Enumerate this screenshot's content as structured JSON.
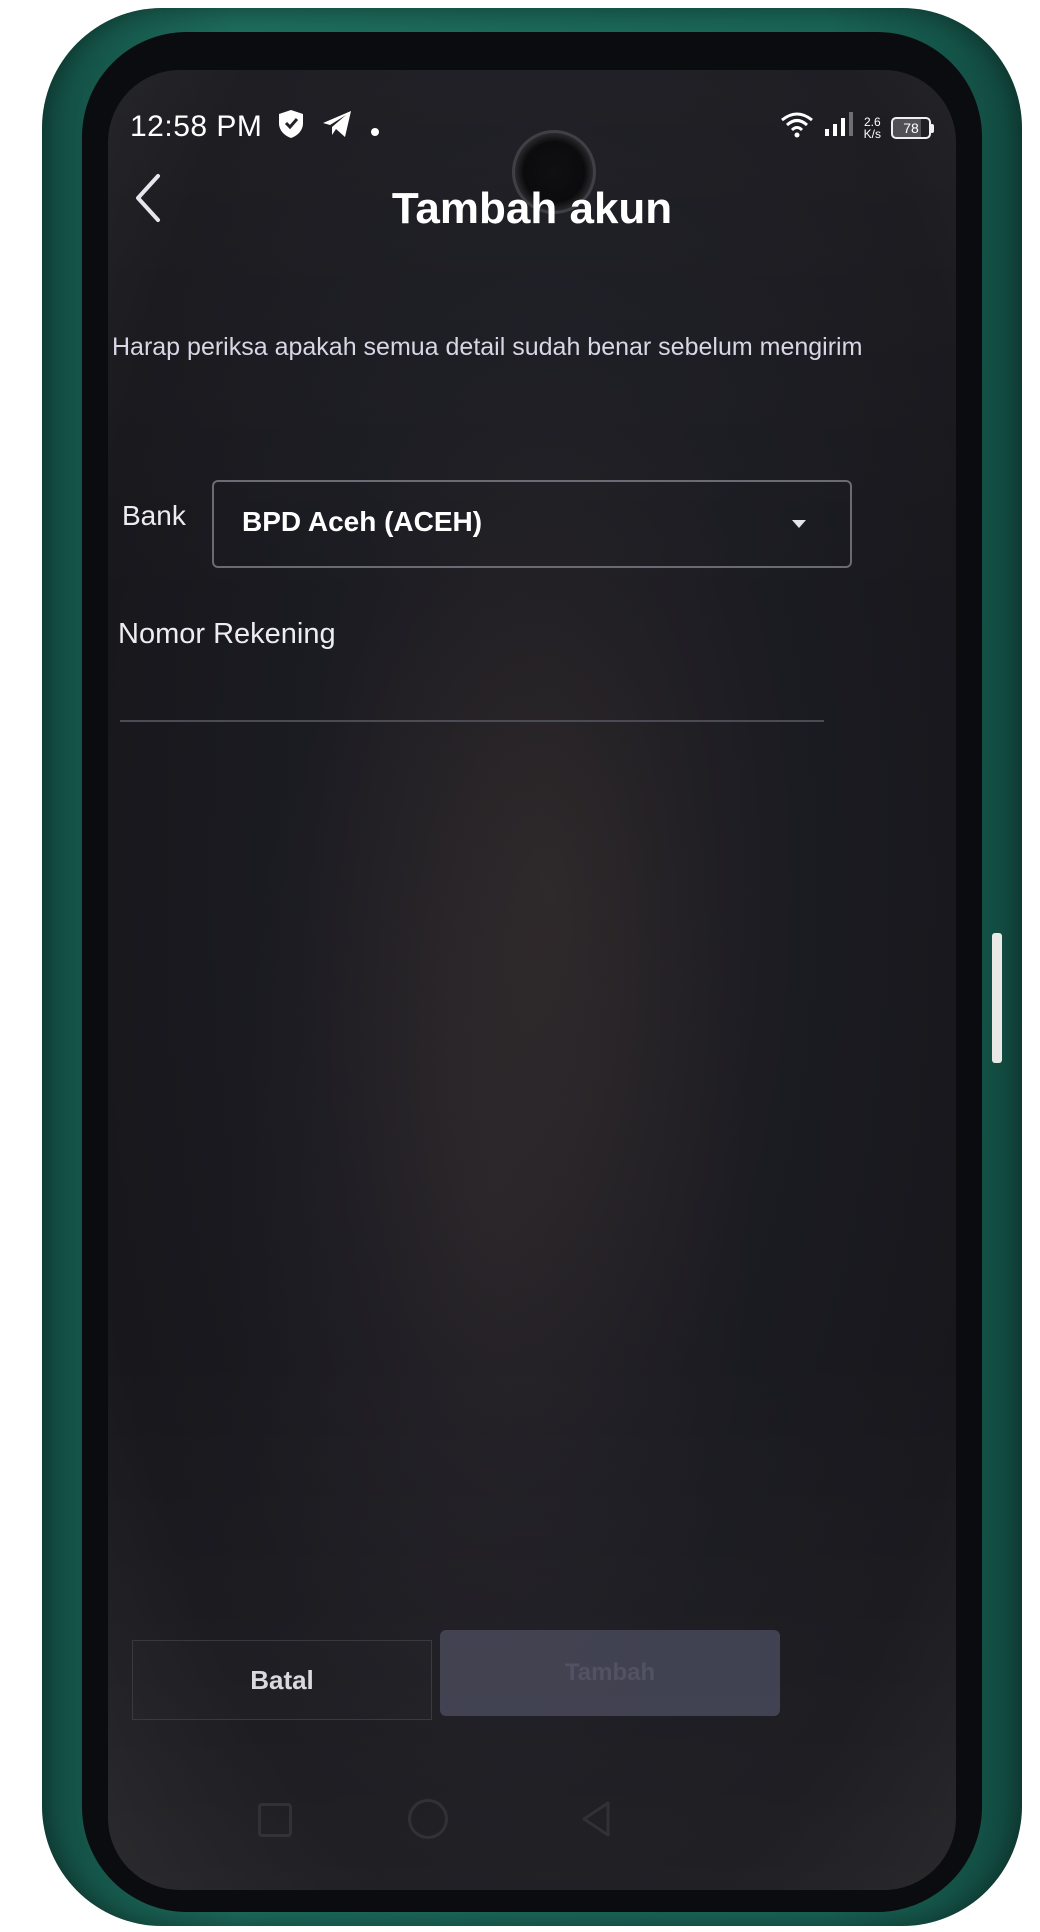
{
  "status_bar": {
    "time": "12:58 PM",
    "net_speed_value": "2.6",
    "net_speed_unit": "K/s",
    "battery": "78",
    "battery_level": 0.78
  },
  "header": {
    "title": "Tambah akun"
  },
  "form": {
    "notice": "Harap periksa apakah semua detail sudah benar sebelum mengirim",
    "bank_label": "Bank",
    "bank_value": "BPD Aceh (ACEH)",
    "account_label": "Nomor Rekening",
    "account_value": ""
  },
  "buttons": {
    "cancel": "Batal",
    "submit": "Tambah"
  },
  "colors": {
    "case_green": "#1e6e5e",
    "screen_bg": "#1b1b22",
    "submit_disabled": "#3c3d4d"
  }
}
